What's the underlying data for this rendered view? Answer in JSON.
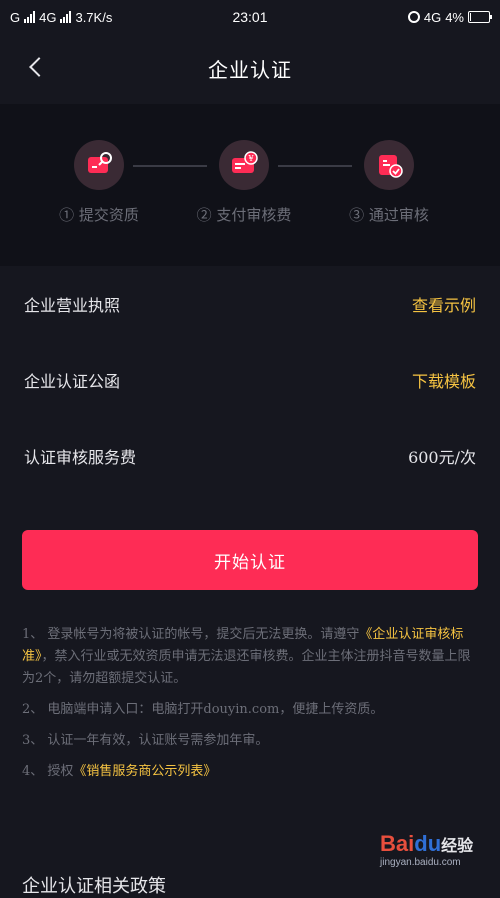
{
  "status_bar": {
    "carrier1": "G",
    "carrier2": "4G",
    "speed": "3.7K/s",
    "time": "23:01",
    "net": "4G",
    "battery": "4%"
  },
  "nav": {
    "title": "企业认证"
  },
  "steps": [
    {
      "label": "① 提交资质",
      "icon": "document-upload-icon"
    },
    {
      "label": "② 支付审核费",
      "icon": "payment-card-icon"
    },
    {
      "label": "③ 通过审核",
      "icon": "approved-check-icon"
    }
  ],
  "rows": [
    {
      "label": "企业营业执照",
      "action": "查看示例"
    },
    {
      "label": "企业认证公函",
      "action": "下载模板"
    },
    {
      "label": "认证审核服务费",
      "value": "600元/次"
    }
  ],
  "button": {
    "label": "开始认证"
  },
  "notes": {
    "n1_prefix": "1、 登录帐号为将被认证的帐号，提交后无法更换。请遵守",
    "n1_link": "《企业认证审核标准》",
    "n1_suffix": "，禁入行业或无效资质申请无法退还审核费。企业主体注册抖音号数量上限为2个，请勿超额提交认证。",
    "n2": "2、 电脑端申请入口：电脑打开douyin.com，便捷上传资质。",
    "n3": "3、 认证一年有效，认证账号需参加年审。",
    "n4_prefix": "4、 授权",
    "n4_link": "《销售服务商公示列表》"
  },
  "bottom_text": "企业认证相关政策",
  "watermark": {
    "logo_a": "Bai",
    "logo_b": "du",
    "logo_c": "经验",
    "sub": "jingyan.baidu.com"
  },
  "colors": {
    "background": "#16171f",
    "accent": "#fe2c55",
    "link": "#f5c342",
    "muted": "#6c6e78"
  }
}
